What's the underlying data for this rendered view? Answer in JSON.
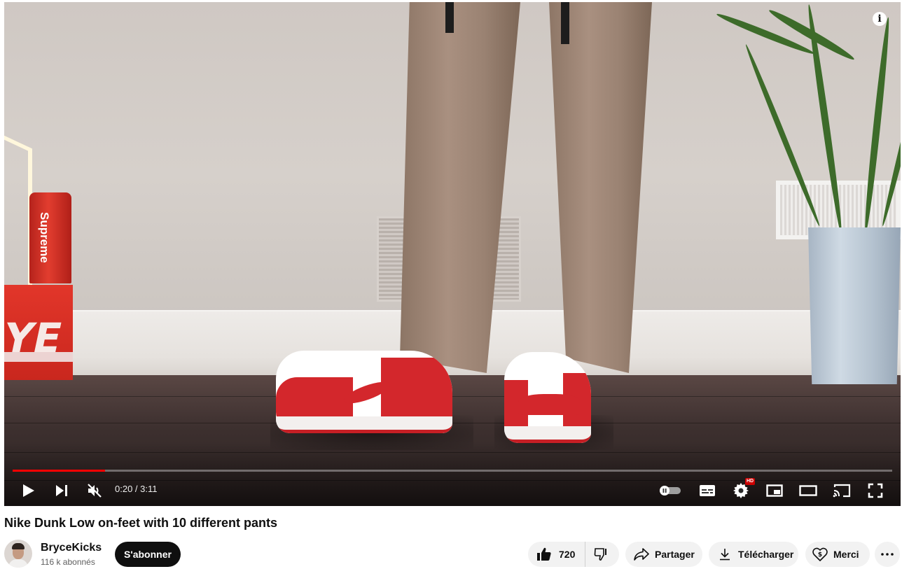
{
  "player": {
    "info_icon": "info-icon",
    "progress_fraction": 0.105,
    "current_time": "0:20",
    "duration": "3:11",
    "time_display": "0:20 / 3:11",
    "muted": true,
    "autoplay_on": false,
    "hd_badge": "HD",
    "accent_color": "#ff0000",
    "scene_text": "Supreme",
    "controls": {
      "play": "play-icon",
      "next": "next-icon",
      "mute": "volume-muted-icon",
      "autoplay": "autoplay-toggle-icon",
      "subtitles": "subtitles-icon",
      "settings": "gear-icon",
      "miniplayer": "miniplayer-icon",
      "theater": "theater-mode-icon",
      "cast": "cast-icon",
      "fullscreen": "fullscreen-icon"
    }
  },
  "video": {
    "title": "Nike Dunk Low on-feet with 10 different pants"
  },
  "channel": {
    "name": "BryceKicks",
    "subscribers": "116 k abonnés",
    "subscribe_label": "S'abonner"
  },
  "actions": {
    "like_count": "720",
    "share_label": "Partager",
    "download_label": "Télécharger",
    "thanks_label": "Merci",
    "more_icon": "more-horizontal-icon"
  }
}
